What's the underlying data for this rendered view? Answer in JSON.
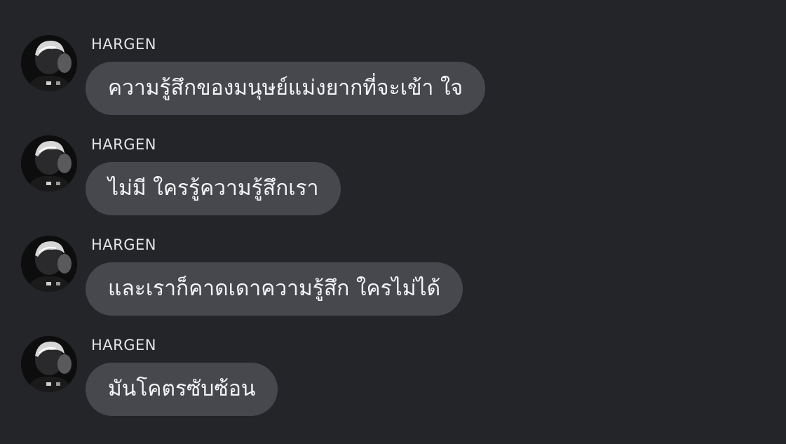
{
  "messages": [
    {
      "sender": "HARGEN",
      "text": "ความรู้สึกของมนุษย์แม่งยากที่จะเข้า ใจ",
      "avatar_icon": "user-avatar-photo"
    },
    {
      "sender": "HARGEN",
      "text": "ไม่มี ใครรู้ความรู้สึกเรา",
      "avatar_icon": "user-avatar-photo"
    },
    {
      "sender": "HARGEN",
      "text": "และเราก็คาดเดาความรู้สึก ใครไม่ได้",
      "avatar_icon": "user-avatar-photo"
    },
    {
      "sender": "HARGEN",
      "text": "มันโคตรซับซ้อน",
      "avatar_icon": "user-avatar-photo"
    }
  ],
  "colors": {
    "background": "#242529",
    "bubble": "#47484e",
    "text": "#f4f4f6",
    "sender": "#e4e5e9"
  }
}
